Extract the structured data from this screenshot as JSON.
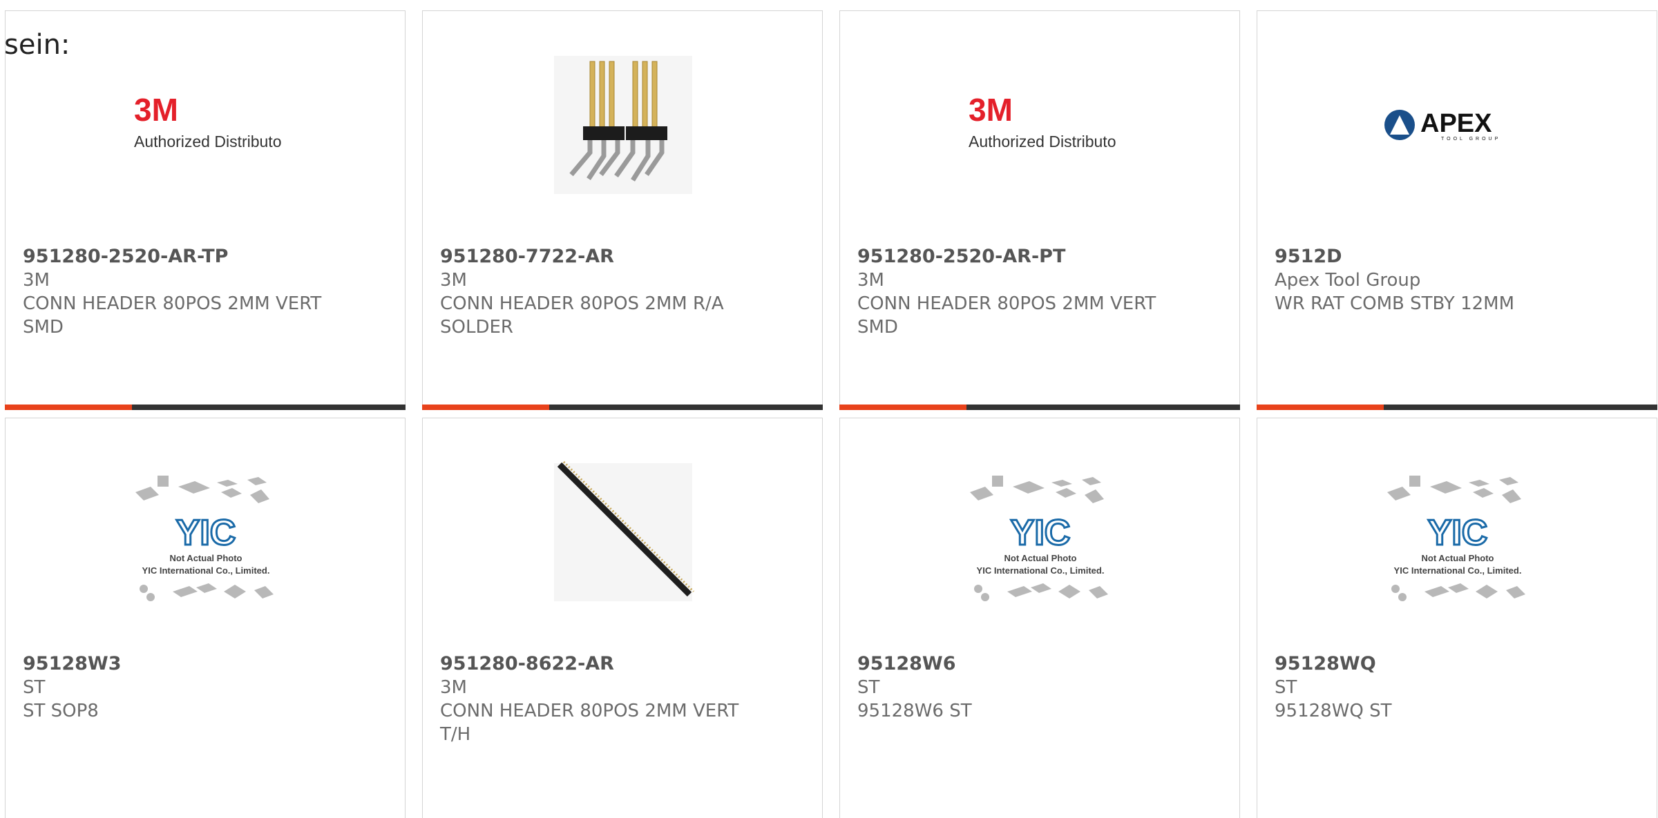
{
  "page": {
    "heading": "sein:"
  },
  "logo_3m": {
    "mark": "3M",
    "tagline": "Authorized Distributor",
    "mark_color": "#e4202a"
  },
  "logo_apex": {
    "name": "APEX",
    "sub": "TOOL GROUP"
  },
  "placeholder": {
    "logo": "YIC",
    "line1": "Not Actual Photo",
    "line2": "YIC International Co., Limited."
  },
  "colors": {
    "accent": "#e8421b",
    "bar": "#333333"
  },
  "products": [
    {
      "part": "951280-2520-AR-TP",
      "brand": "3M",
      "desc": "CONN HEADER 80POS 2MM VERT SMD",
      "image": "3m-logo"
    },
    {
      "part": "951280-7722-AR",
      "brand": "3M",
      "desc": "CONN HEADER 80POS 2MM R/A SOLDER",
      "image": "header-photo"
    },
    {
      "part": "951280-2520-AR-PT",
      "brand": "3M",
      "desc": "CONN HEADER 80POS 2MM VERT SMD",
      "image": "3m-logo"
    },
    {
      "part": "9512D",
      "brand": "Apex Tool Group",
      "desc": "WR RAT COMB STBY 12MM",
      "image": "apex-logo"
    },
    {
      "part": "95128W3",
      "brand": "ST",
      "desc": "ST SOP8",
      "image": "placeholder"
    },
    {
      "part": "951280-8622-AR",
      "brand": "3M",
      "desc": "CONN HEADER 80POS 2MM VERT T/H",
      "image": "pin-strip"
    },
    {
      "part": "95128W6",
      "brand": "ST",
      "desc": "95128W6 ST",
      "image": "placeholder"
    },
    {
      "part": "95128WQ",
      "brand": "ST",
      "desc": "95128WQ ST",
      "image": "placeholder"
    }
  ]
}
